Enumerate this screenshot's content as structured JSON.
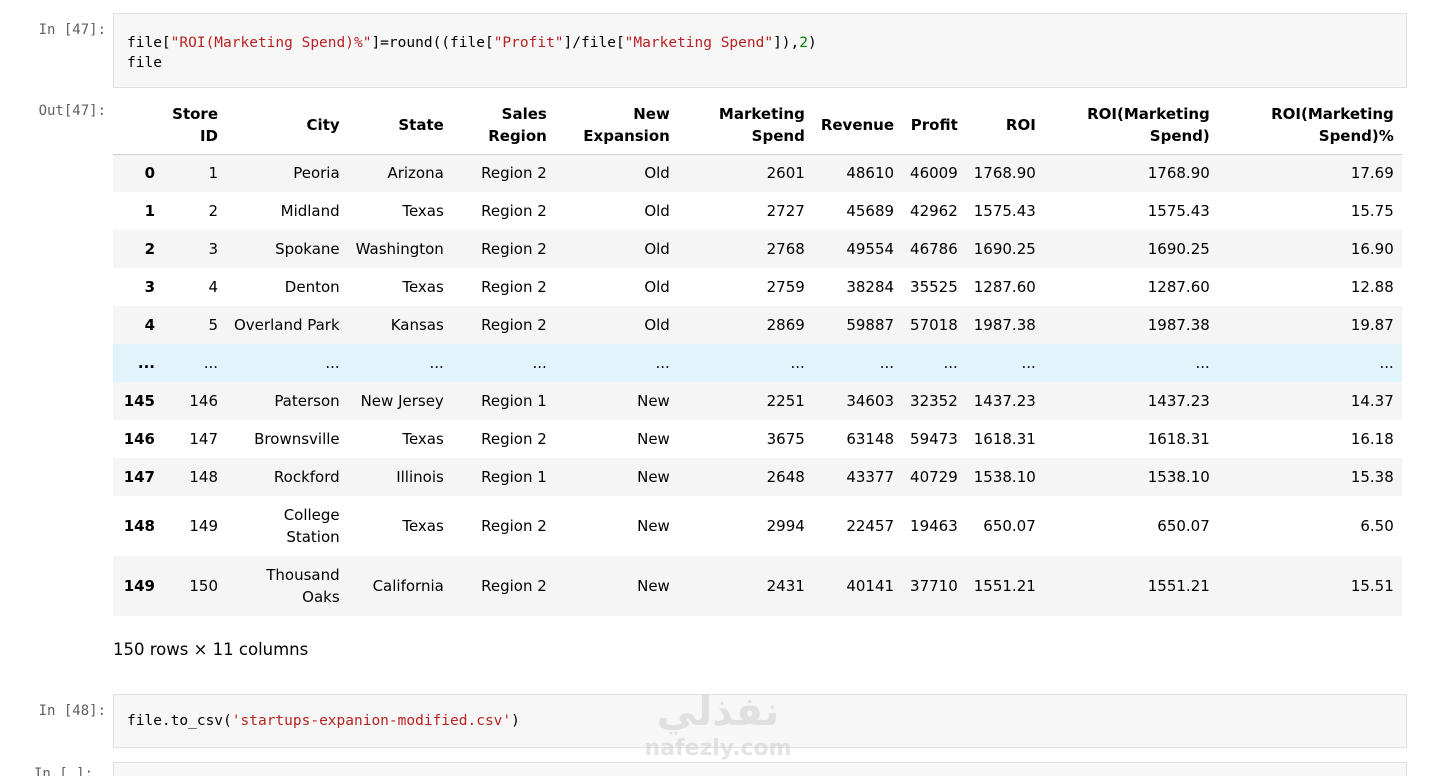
{
  "cells": [
    {
      "in_prompt": "In [47]:",
      "code_lines": [
        [
          {
            "t": "file",
            "c": "tok-name"
          },
          {
            "t": "[",
            "c": "tok-op"
          },
          {
            "t": "\"ROI(Marketing Spend)%\"",
            "c": "tok-str"
          },
          {
            "t": "]=",
            "c": "tok-op"
          },
          {
            "t": "round",
            "c": "tok-name"
          },
          {
            "t": "((",
            "c": "tok-op"
          },
          {
            "t": "file",
            "c": "tok-name"
          },
          {
            "t": "[",
            "c": "tok-op"
          },
          {
            "t": "\"Profit\"",
            "c": "tok-str"
          },
          {
            "t": "]/",
            "c": "tok-op"
          },
          {
            "t": "file",
            "c": "tok-name"
          },
          {
            "t": "[",
            "c": "tok-op"
          },
          {
            "t": "\"Marketing Spend\"",
            "c": "tok-str"
          },
          {
            "t": "]),",
            "c": "tok-op"
          },
          {
            "t": "2",
            "c": "tok-num"
          },
          {
            "t": ")",
            "c": "tok-op"
          }
        ],
        [
          {
            "t": "file",
            "c": "tok-name"
          }
        ]
      ],
      "out_prompt": "Out[47]:"
    },
    {
      "in_prompt": "In [48]:",
      "code_lines": [
        [
          {
            "t": "file",
            "c": "tok-name"
          },
          {
            "t": ".",
            "c": "tok-op"
          },
          {
            "t": "to_csv",
            "c": "tok-name"
          },
          {
            "t": "(",
            "c": "tok-op"
          },
          {
            "t": "'startups-expanion-modified.csv'",
            "c": "tok-str"
          },
          {
            "t": ")",
            "c": "tok-op"
          }
        ]
      ]
    }
  ],
  "next_prompt": "In [ ]:",
  "dataframe": {
    "columns": [
      "",
      "Store ID",
      "City",
      "State",
      "Sales Region",
      "New Expansion",
      "Marketing Spend",
      "Revenue",
      "Profit",
      "ROI",
      "ROI(Marketing Spend)",
      "ROI(Marketing Spend)%"
    ],
    "rows": [
      [
        "0",
        "1",
        "Peoria",
        "Arizona",
        "Region 2",
        "Old",
        "2601",
        "48610",
        "46009",
        "1768.90",
        "1768.90",
        "17.69"
      ],
      [
        "1",
        "2",
        "Midland",
        "Texas",
        "Region 2",
        "Old",
        "2727",
        "45689",
        "42962",
        "1575.43",
        "1575.43",
        "15.75"
      ],
      [
        "2",
        "3",
        "Spokane",
        "Washington",
        "Region 2",
        "Old",
        "2768",
        "49554",
        "46786",
        "1690.25",
        "1690.25",
        "16.90"
      ],
      [
        "3",
        "4",
        "Denton",
        "Texas",
        "Region 2",
        "Old",
        "2759",
        "38284",
        "35525",
        "1287.60",
        "1287.60",
        "12.88"
      ],
      [
        "4",
        "5",
        "Overland Park",
        "Kansas",
        "Region 2",
        "Old",
        "2869",
        "59887",
        "57018",
        "1987.38",
        "1987.38",
        "19.87"
      ],
      [
        "...",
        "...",
        "...",
        "...",
        "...",
        "...",
        "...",
        "...",
        "...",
        "...",
        "...",
        "..."
      ],
      [
        "145",
        "146",
        "Paterson",
        "New Jersey",
        "Region 1",
        "New",
        "2251",
        "34603",
        "32352",
        "1437.23",
        "1437.23",
        "14.37"
      ],
      [
        "146",
        "147",
        "Brownsville",
        "Texas",
        "Region 2",
        "New",
        "3675",
        "63148",
        "59473",
        "1618.31",
        "1618.31",
        "16.18"
      ],
      [
        "147",
        "148",
        "Rockford",
        "Illinois",
        "Region 1",
        "New",
        "2648",
        "43377",
        "40729",
        "1538.10",
        "1538.10",
        "15.38"
      ],
      [
        "148",
        "149",
        "College Station",
        "Texas",
        "Region 2",
        "New",
        "2994",
        "22457",
        "19463",
        "650.07",
        "650.07",
        "6.50"
      ],
      [
        "149",
        "150",
        "Thousand Oaks",
        "California",
        "Region 2",
        "New",
        "2431",
        "40141",
        "37710",
        "1551.21",
        "1551.21",
        "15.51"
      ]
    ],
    "shape_text": "150 rows × 11 columns"
  },
  "watermark": {
    "arabic": "نفذلي",
    "latin": "nafezly.com"
  }
}
